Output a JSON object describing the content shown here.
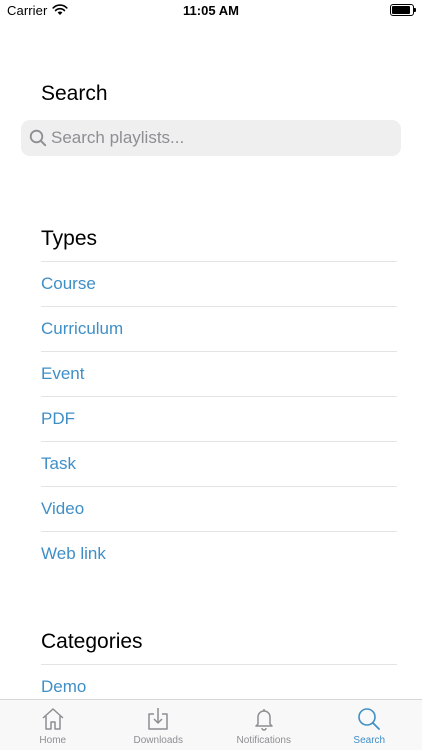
{
  "status_bar": {
    "carrier": "Carrier",
    "time": "11:05 AM",
    "battery_level": 0.9
  },
  "search": {
    "title": "Search",
    "placeholder": "Search playlists..."
  },
  "types": {
    "title": "Types",
    "items": [
      {
        "label": "Course"
      },
      {
        "label": "Curriculum"
      },
      {
        "label": "Event"
      },
      {
        "label": "PDF"
      },
      {
        "label": "Task"
      },
      {
        "label": "Video"
      },
      {
        "label": "Web link"
      }
    ]
  },
  "categories": {
    "title": "Categories",
    "items": [
      {
        "label": "Demo"
      }
    ]
  },
  "tab_bar": {
    "tabs": [
      {
        "label": "Home",
        "icon": "home-icon"
      },
      {
        "label": "Downloads",
        "icon": "download-icon"
      },
      {
        "label": "Notifications",
        "icon": "bell-icon"
      },
      {
        "label": "Search",
        "icon": "search-icon",
        "active": true
      }
    ]
  },
  "colors": {
    "accent": "#3f8fc7",
    "inactive": "#8e8e93",
    "search_field": "#efeff0"
  }
}
